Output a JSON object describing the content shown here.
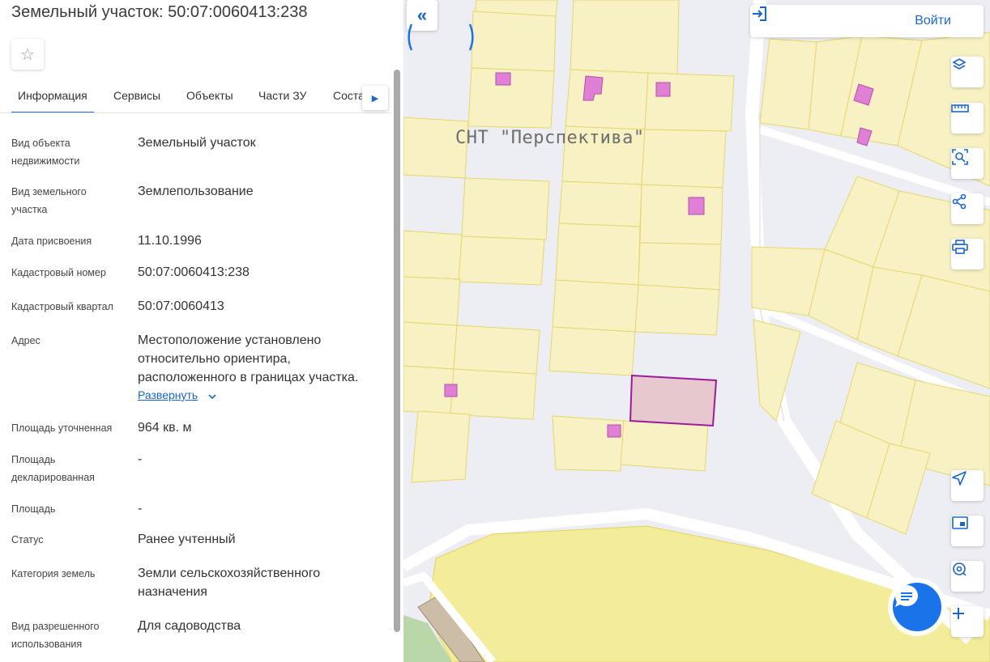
{
  "title": "Земельный участок: 50:07:0060413:238",
  "tabs": [
    {
      "label": "Информация"
    },
    {
      "label": "Сервисы"
    },
    {
      "label": "Объекты"
    },
    {
      "label": "Части ЗУ"
    },
    {
      "label": "Соста"
    }
  ],
  "info_rows": [
    {
      "label": "Вид объекта недвижимости",
      "value": "Земельный участок"
    },
    {
      "label": "Вид земельного участка",
      "value": "Землепользование"
    },
    {
      "label": "Дата присвоения",
      "value": "11.10.1996"
    },
    {
      "label": "Кадастровый номер",
      "value": "50:07:0060413:238"
    },
    {
      "label": "Кадастровый квартал",
      "value": "50:07:0060413"
    },
    {
      "label": "Адрес",
      "value": "Местоположение установлено относительно ориентира, расположенного в границах участка."
    },
    {
      "label": "Площадь уточненная",
      "value": "964 кв. м"
    },
    {
      "label": "Площадь декларированная",
      "value": "-"
    },
    {
      "label": "Площадь",
      "value": "-"
    },
    {
      "label": "Статус",
      "value": "Ранее учтенный"
    },
    {
      "label": "Категория земель",
      "value": "Земли сельскохозяйственного назначения"
    },
    {
      "label": "Вид разрешенного использования",
      "value": "Для садоводства"
    }
  ],
  "expand_label": "Развернуть",
  "map": {
    "snt_label": "СНТ \"Перспектива\"",
    "login_label": "Войти",
    "colors": {
      "parcel_fill": "#f7f1c4",
      "parcel_stroke": "#e6d66a",
      "building": "#e07fd6",
      "selected_fill": "#e8c8cf",
      "selected_stroke": "#9b1c98",
      "accent": "#1a66c9"
    }
  },
  "icons": {
    "favorite": "star-icon",
    "collapse": "double-chevron-left-icon",
    "tools": [
      "layers-icon",
      "ruler-icon",
      "select-area-icon",
      "share-icon",
      "print-icon",
      "locate-icon",
      "minimap-icon",
      "geo-search-icon",
      "zoom-in-icon"
    ],
    "chat": "chat-icon"
  }
}
